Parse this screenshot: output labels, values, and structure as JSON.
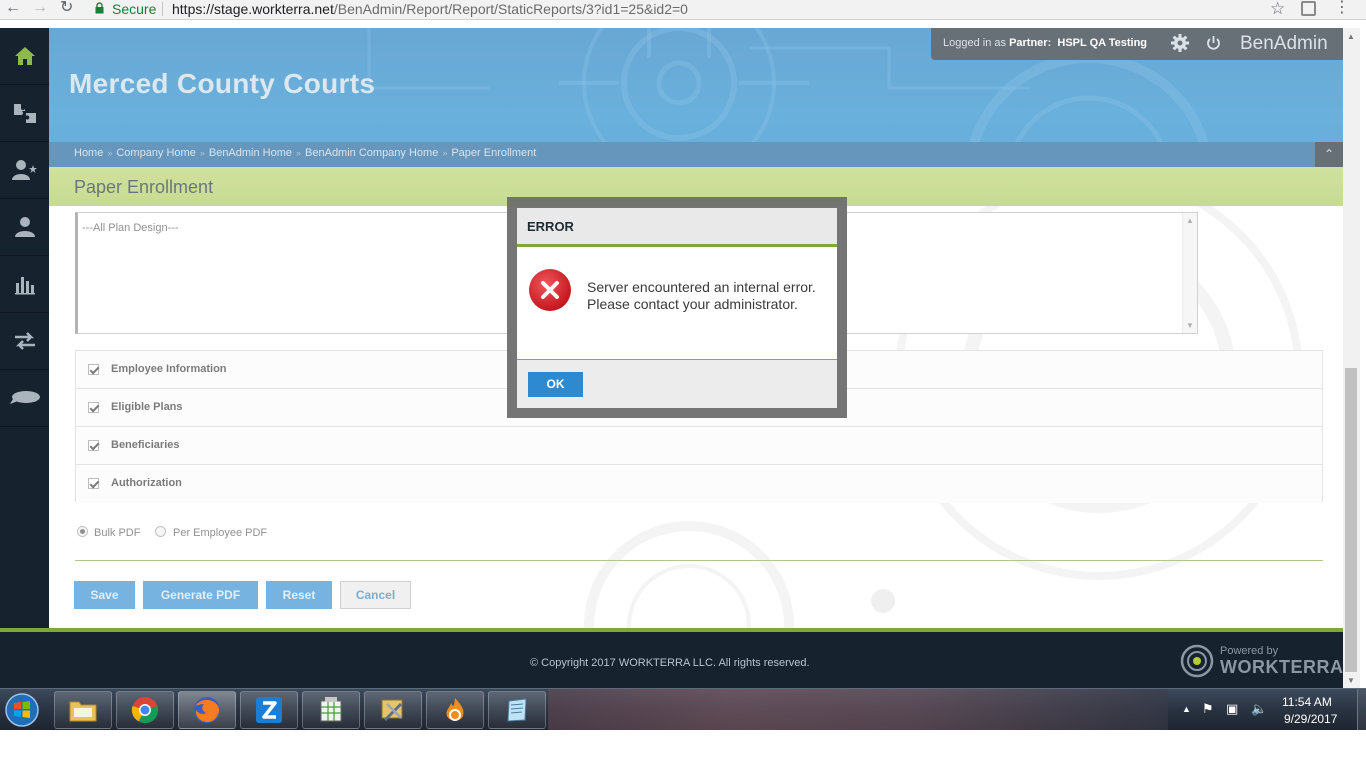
{
  "browser": {
    "secure_label": "Secure",
    "url_scheme_host": "https://stage.workterra.net",
    "url_path": "/BenAdmin/Report/Report/StaticReports/3?id1=25&id2=0"
  },
  "header": {
    "company_title": "Merced County Courts",
    "logged_in_prefix": "Logged in as ",
    "partner_label": "Partner:",
    "partner_name": "HSPL QA Testing",
    "app_name": "BenAdmin",
    "breadcrumbs": [
      "Home",
      "Company Home",
      "BenAdmin Home",
      "BenAdmin Company Home",
      "Paper Enrollment"
    ],
    "breadcrumb_sep": "»"
  },
  "page": {
    "title": "Paper Enrollment",
    "plan_design_option": "---All Plan Design---",
    "sections": [
      {
        "label": "Employee Information",
        "checked": true
      },
      {
        "label": "Eligible Plans",
        "checked": true
      },
      {
        "label": "Beneficiaries",
        "checked": true
      },
      {
        "label": "Authorization",
        "checked": true
      }
    ],
    "radio_options": [
      {
        "label": "Bulk PDF",
        "selected": true
      },
      {
        "label": "Per Employee PDF",
        "selected": false
      }
    ],
    "buttons": {
      "save": "Save",
      "generate_pdf": "Generate PDF",
      "reset": "Reset",
      "cancel": "Cancel"
    }
  },
  "modal": {
    "title": "ERROR",
    "message": "Server encountered an internal error. Please contact your administrator.",
    "ok_label": "OK"
  },
  "footer": {
    "copyright": "© Copyright 2017 WORKTERRA LLC. All rights reserved.",
    "powered_by": "Powered by",
    "brand": "WORKTERRA"
  },
  "taskbar": {
    "time": "11:54 AM",
    "date": "9/29/2017"
  },
  "colors": {
    "accent_blue": "#2d8ad1",
    "accent_green": "#7da83a",
    "dark_navy": "#16232f",
    "error_red": "#d9262e"
  }
}
